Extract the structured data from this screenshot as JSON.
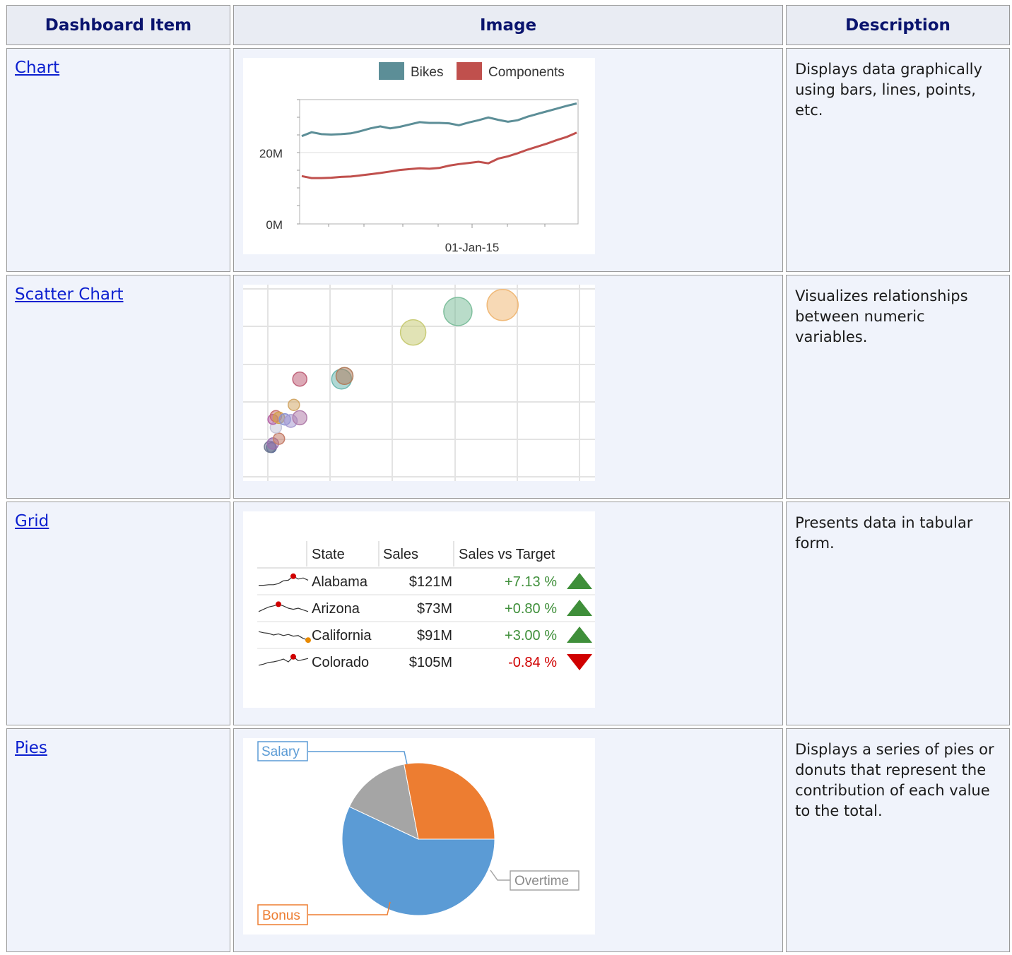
{
  "header": {
    "col_item": "Dashboard Item",
    "col_image": "Image",
    "col_description": "Description"
  },
  "rows": [
    {
      "item": "Chart",
      "description": "Displays data graphically using bars, lines, points, etc."
    },
    {
      "item": "Scatter Chart",
      "description": "Visualizes relationships between numeric variables."
    },
    {
      "item": "Grid",
      "description": "Presents data in tabular form."
    },
    {
      "item": "Pies",
      "description": "Displays a series of pies or donuts that represent the contribution of each value to the total."
    }
  ],
  "chart_data": [
    {
      "type": "line",
      "legend": [
        "Bikes",
        "Components"
      ],
      "legend_position": "top",
      "ytick_labels": [
        "20M",
        "0M"
      ],
      "xtick_labels": [
        "01-Jan-15"
      ],
      "ylim": [
        0,
        32000000
      ],
      "x": [
        0,
        1,
        2,
        3,
        4,
        5,
        6,
        7,
        8,
        9,
        10,
        11,
        12,
        13,
        14,
        15,
        16,
        17,
        18,
        19,
        20,
        21,
        22,
        23,
        24,
        25,
        26,
        27,
        28
      ],
      "series": [
        {
          "name": "Bikes",
          "color": "#5c8e97",
          "values": [
            22.6,
            23.6,
            23.1,
            23.0,
            23.1,
            23.3,
            23.9,
            24.6,
            25.1,
            24.6,
            25.0,
            25.6,
            26.2,
            26.0,
            26.0,
            25.9,
            25.4,
            26.1,
            26.7,
            27.4,
            26.8,
            26.3,
            26.7,
            27.6,
            28.3,
            29.0,
            29.7,
            30.4,
            31.0
          ]
        },
        {
          "name": "Components",
          "color": "#c0504d",
          "values": [
            12.3,
            11.8,
            11.8,
            11.9,
            12.1,
            12.2,
            12.5,
            12.8,
            13.1,
            13.5,
            13.9,
            14.1,
            14.3,
            14.2,
            14.4,
            15.0,
            15.4,
            15.7,
            16.0,
            15.6,
            16.8,
            17.4,
            18.2,
            19.1,
            19.9,
            20.7,
            21.6,
            22.4,
            23.5
          ]
        }
      ],
      "grid": true
    },
    {
      "type": "scatter",
      "grid": true,
      "points": [
        {
          "x": 0.78,
          "y": 0.97,
          "r": 22,
          "color": "#f0b978"
        },
        {
          "x": 0.63,
          "y": 0.93,
          "r": 20,
          "color": "#7fbf9d"
        },
        {
          "x": 0.48,
          "y": 0.8,
          "r": 18,
          "color": "#c9cc78"
        },
        {
          "x": 0.25,
          "y": 0.53,
          "r": 12,
          "color": "#b07e5e"
        },
        {
          "x": 0.24,
          "y": 0.51,
          "r": 14,
          "color": "#6fb8b0"
        },
        {
          "x": 0.1,
          "y": 0.51,
          "r": 10,
          "color": "#c0637a"
        },
        {
          "x": 0.08,
          "y": 0.35,
          "r": 8,
          "color": "#d3a96a"
        },
        {
          "x": 0.1,
          "y": 0.27,
          "r": 10,
          "color": "#b27fac"
        },
        {
          "x": 0.07,
          "y": 0.25,
          "r": 9,
          "color": "#a89bd1"
        },
        {
          "x": 0.05,
          "y": 0.26,
          "r": 8,
          "color": "#8a93d2"
        },
        {
          "x": 0.03,
          "y": 0.27,
          "r": 8,
          "color": "#d4a34a"
        },
        {
          "x": 0.02,
          "y": 0.28,
          "r": 8,
          "color": "#c86e6e"
        },
        {
          "x": 0.01,
          "y": 0.26,
          "r": 7,
          "color": "#b45fa6"
        },
        {
          "x": 0.02,
          "y": 0.21,
          "r": 8,
          "color": "#c7c7d9"
        },
        {
          "x": 0.03,
          "y": 0.14,
          "r": 8,
          "color": "#c57e6a"
        },
        {
          "x": 0.01,
          "y": 0.11,
          "r": 8,
          "color": "#9b6fae"
        },
        {
          "x": 0.0,
          "y": 0.09,
          "r": 8,
          "color": "#727c94"
        },
        {
          "x": 0.005,
          "y": 0.085,
          "r": 7,
          "color": "#5b6b9a"
        }
      ]
    },
    {
      "type": "table",
      "columns": [
        "State",
        "Sales",
        "Sales vs Target"
      ],
      "rows": [
        {
          "state": "Alabama",
          "sales": "$121M",
          "vs_target": "+7.13 %",
          "trend": "up"
        },
        {
          "state": "Arizona",
          "sales": "$73M",
          "vs_target": "+0.80 %",
          "trend": "up"
        },
        {
          "state": "California",
          "sales": "$91M",
          "vs_target": "+3.00 %",
          "trend": "up"
        },
        {
          "state": "Colorado",
          "sales": "$105M",
          "vs_target": "-0.84 %",
          "trend": "down"
        }
      ],
      "sparklines": [
        [
          0.15,
          0.15,
          0.2,
          0.2,
          0.3,
          0.55,
          0.6,
          0.95,
          0.7,
          0.8,
          0.6
        ],
        [
          0.2,
          0.4,
          0.6,
          0.7,
          0.85,
          0.7,
          0.5,
          0.4,
          0.5,
          0.35,
          0.2
        ],
        [
          0.8,
          0.7,
          0.65,
          0.5,
          0.6,
          0.45,
          0.55,
          0.4,
          0.45,
          0.2,
          0.05
        ],
        [
          0.2,
          0.3,
          0.45,
          0.5,
          0.6,
          0.75,
          0.5,
          0.95,
          0.6,
          0.7,
          0.8
        ]
      ],
      "up_color": "#3f8f3a",
      "down_color": "#d00000"
    },
    {
      "type": "pie",
      "slices": [
        {
          "label": "Salary",
          "value": 57,
          "color": "#5b9bd5"
        },
        {
          "label": "Overtime",
          "value": 15,
          "color": "#a5a5a5"
        },
        {
          "label": "Bonus",
          "value": 28,
          "color": "#ed7d31"
        }
      ]
    }
  ]
}
